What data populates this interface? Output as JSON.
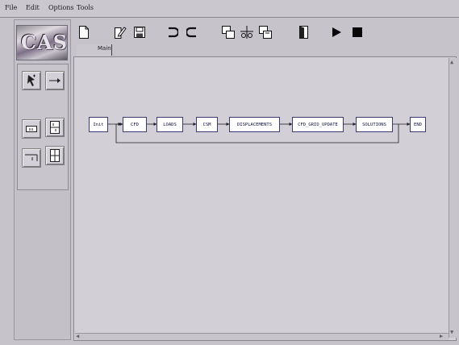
{
  "menu": {
    "file": "File",
    "edit": "Edit",
    "options": "Options",
    "tools": "Tools"
  },
  "logo": {
    "text": "CAST"
  },
  "tab": {
    "label": "Main"
  },
  "flow": {
    "nodes": [
      "Init",
      "CFD",
      "LOADS",
      "CSM",
      "DISPLACEMENTS",
      "CFD_GRID_UPDATE",
      "SOLUTIONS",
      "END"
    ],
    "loop": "SOLUTIONS back to CFD"
  },
  "icons": {
    "toolbar": [
      "new-file-icon",
      "edit-pencil-icon",
      "save-icon",
      "undo-icon",
      "redo-icon",
      "copy-icon",
      "cut-icon",
      "paste-icon",
      "exit-door-icon",
      "play-icon",
      "stop-icon"
    ],
    "tools": [
      "select-pointer-icon",
      "connect-arrow-icon",
      "single-block-icon",
      "double-block-icon",
      "branch-icon",
      "grid-block-icon"
    ]
  },
  "colors": {
    "background": "#c7c3cb",
    "canvas": "#d2cfd6",
    "node_border": "#3a3a70",
    "node_fill": "#ffffff"
  }
}
